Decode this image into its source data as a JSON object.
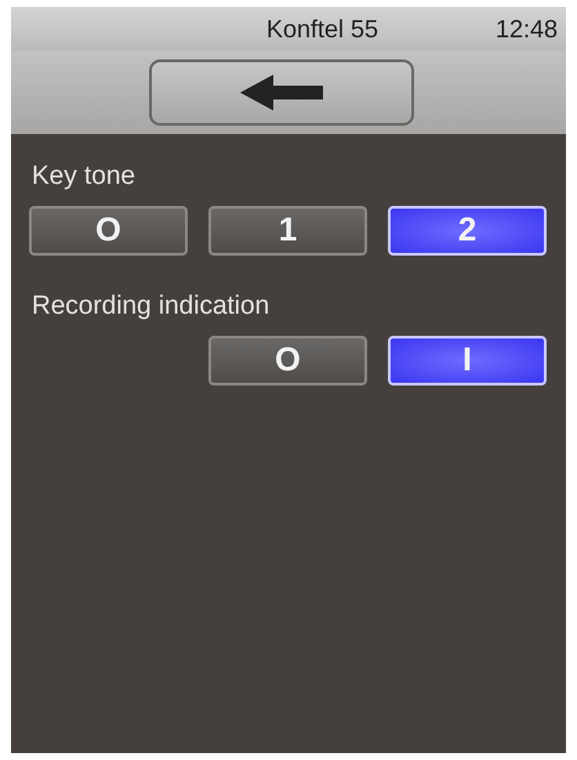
{
  "status_bar": {
    "title": "Konftel 55",
    "time": "12:48"
  },
  "settings": [
    {
      "label": "Key tone",
      "options": [
        {
          "label": "O",
          "selected": false
        },
        {
          "label": "1",
          "selected": false
        },
        {
          "label": "2",
          "selected": true
        }
      ]
    },
    {
      "label": "Recording indication",
      "options": [
        {
          "label": "O",
          "selected": false
        },
        {
          "label": "I",
          "selected": true
        }
      ]
    }
  ]
}
